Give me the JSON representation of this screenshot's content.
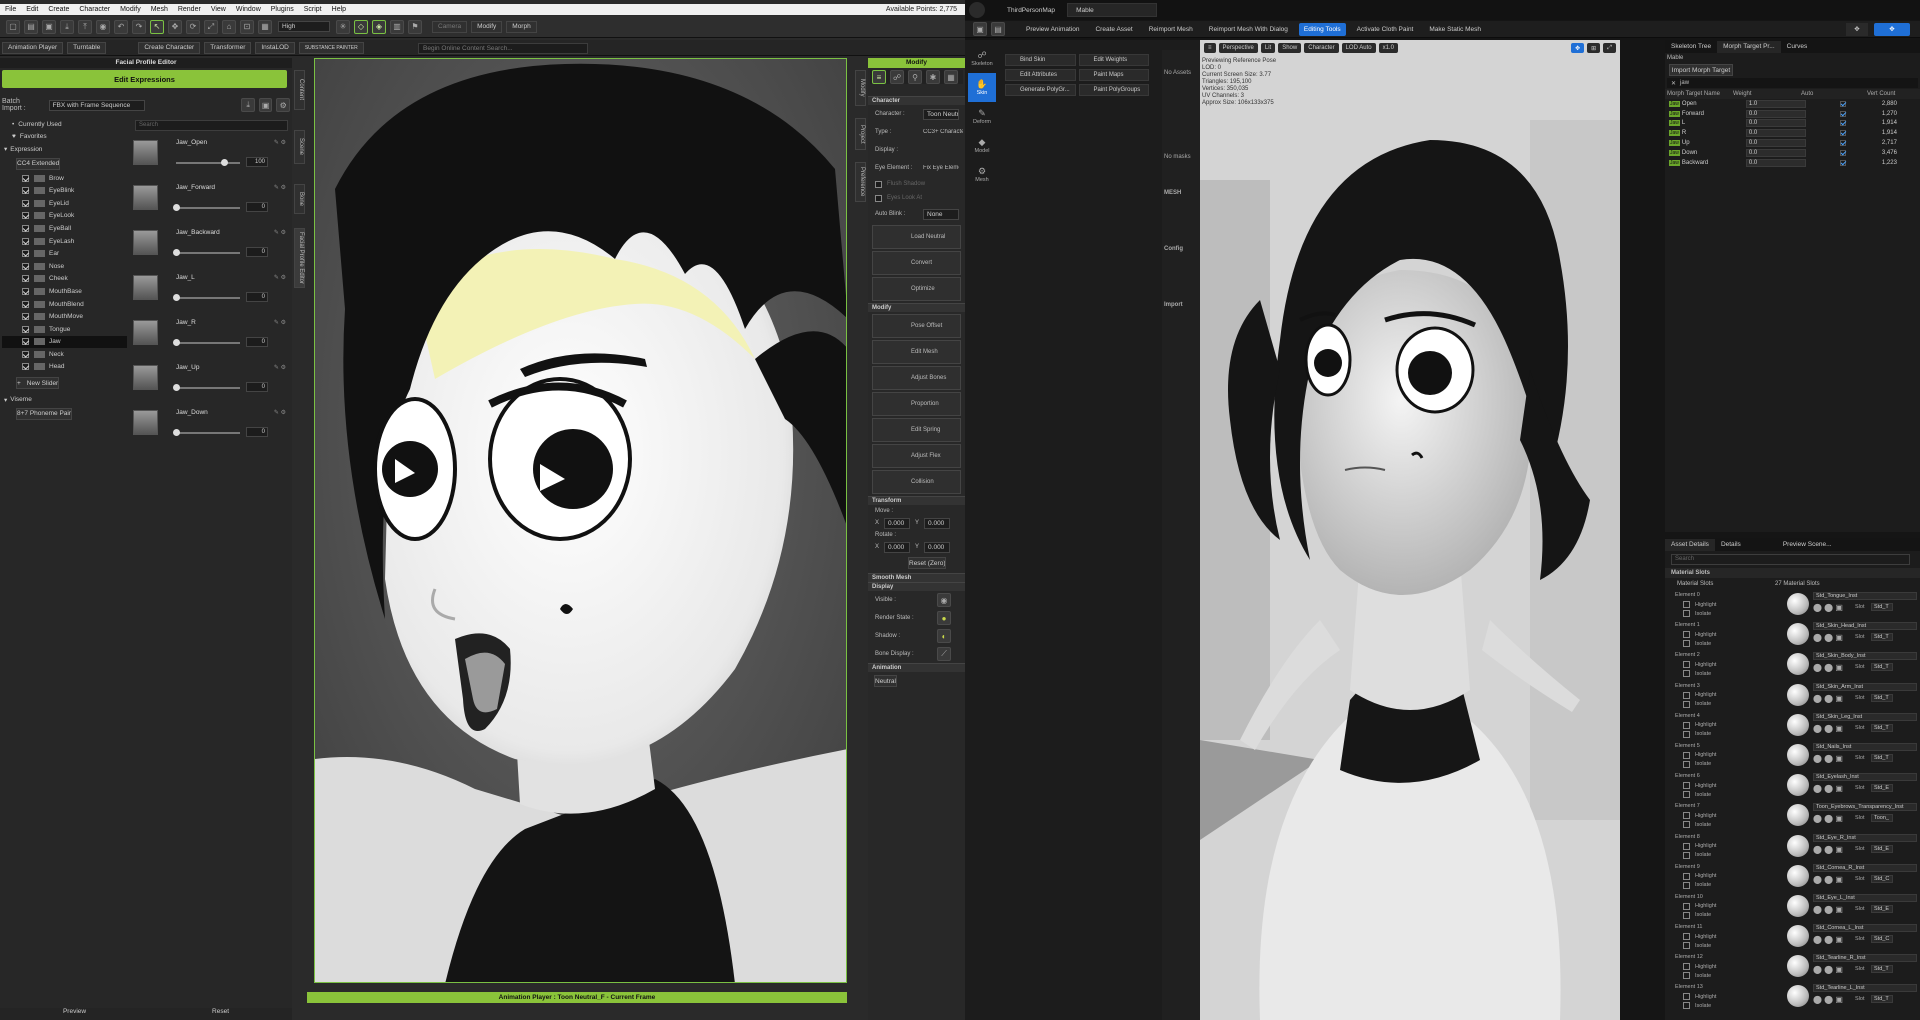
{
  "cc": {
    "menu": [
      "File",
      "Edit",
      "Create",
      "Character",
      "Modify",
      "Mesh",
      "Render",
      "View",
      "Window",
      "Plugins",
      "Script",
      "Help"
    ],
    "available_points": "Available Points: 2,775",
    "quality": "High",
    "toolbar_right": {
      "modify": "Modify",
      "morph": "Morph",
      "camera": "Camera"
    },
    "tabs": {
      "anim_player": "Animation Player",
      "turntable": "Turntable",
      "create_char": "Create Character",
      "transformer": "Transformer",
      "instalod": "InstaLOD",
      "substance": "SUBSTANCE PAINTER"
    },
    "search_placeholder": "Begin Online Content Search...",
    "fpe": {
      "title": "Facial Profile Editor",
      "edit_expressions": "Edit Expressions",
      "batch_label": "Batch Import :",
      "batch_value": "FBX with Frame Sequence",
      "currently_used": "Currently Used",
      "favorites": "Favorites",
      "expression": "Expression",
      "cc4_extended": "CC4 Extended",
      "items": [
        "Brow",
        "EyeBlink",
        "EyeLid",
        "EyeLook",
        "EyeBall",
        "EyeLash",
        "Ear",
        "Nose",
        "Cheek",
        "MouthBase",
        "MouthBlend",
        "MouthMove",
        "Tongue",
        "Jaw",
        "Neck",
        "Head"
      ],
      "new_slider": "New Slider",
      "viseme": "Viseme",
      "phoneme_pair": "8+7 Phoneme Pair",
      "search_placeholder": "Search",
      "sliders": [
        {
          "name": "Jaw_Open",
          "value": "100",
          "level": 0.75
        },
        {
          "name": "Jaw_Forward",
          "value": "0",
          "level": 0
        },
        {
          "name": "Jaw_Backward",
          "value": "0",
          "level": 0
        },
        {
          "name": "Jaw_L",
          "value": "0",
          "level": 0
        },
        {
          "name": "Jaw_R",
          "value": "0",
          "level": 0
        },
        {
          "name": "Jaw_Up",
          "value": "0",
          "level": 0
        },
        {
          "name": "Jaw_Down",
          "value": "0",
          "level": 0
        }
      ],
      "preview": "Preview",
      "reset": "Reset"
    },
    "vtabs": [
      "Content",
      "Scene",
      "Bone",
      "Facial Profile Editor"
    ],
    "vtabs_right": [
      "Modify",
      "Project",
      "Preference"
    ],
    "anim_footer": "Animation Player : Toon Neutral_F - Current Frame",
    "modify": {
      "title": "Modify",
      "character_sec": "Character",
      "character_label": "Character :",
      "character_value": "Toon Neutral",
      "type_label": "Type :",
      "type_value": "CC3+ Character",
      "display_label": "Display :",
      "eye_label": "Eye Element :",
      "eye_value": "Fix Eye Element",
      "flush_shadow": "Flush Shadow",
      "eyes_look": "Eyes Look At",
      "auto_blink": "Auto Blink :",
      "auto_blink_value": "None",
      "btns1": [
        "Load Neutral",
        "Convert",
        "Optimize"
      ],
      "modify_sec": "Modify",
      "btns2": [
        "Pose Offset",
        "Edit Mesh",
        "Adjust Bones",
        "Proportion",
        "Edit Spring",
        "Adjust Flex",
        "Collision"
      ],
      "transform_sec": "Transform",
      "move": "Move :",
      "rotate": "Rotate :",
      "x_val": "0.000",
      "y_val": "0.000",
      "reset_zero": "Reset (Zero)",
      "smooth_sec": "Smooth Mesh",
      "display_sec": "Display",
      "visible": "Visible :",
      "render_state": "Render State :",
      "shadow": "Shadow :",
      "bone_display": "Bone Display :",
      "animation_sec": "Animation",
      "neutral": "Neutral"
    }
  },
  "ue": {
    "tabs": [
      "ThirdPersonMap",
      "Mable"
    ],
    "toolbar": [
      "Preview Animation",
      "Create Asset",
      "Reimport Mesh",
      "Reimport Mesh With Dialog",
      "Editing Tools",
      "Activate Cloth Paint",
      "Make Static Mesh"
    ],
    "side": [
      "Skeleton",
      "Skin",
      "Deform",
      "Model",
      "Mesh"
    ],
    "tools": [
      "Bind Skin",
      "Edit Weights",
      "Edit Attributes",
      "Paint Maps",
      "Generate PolyGr...",
      "Paint PolyGroups"
    ],
    "no_assets": "No Assets",
    "no_masks": "No masks",
    "mesh": "MESH",
    "config": "Config",
    "import": "Import",
    "viewport_bar": [
      "Perspective",
      "Lit",
      "Show",
      "Character",
      "LOD Auto",
      "x1.0"
    ],
    "viewport_info": [
      "Previewing Reference Pose",
      "LOD: 0",
      "Current Screen Size: 3.77",
      "Triangles: 195,100",
      "Vertices: 350,035",
      "UV Channels: 3",
      "Approx Size: 106x133x375"
    ],
    "panel_tabs": [
      "Skeleton Tree",
      "Morph Target Pr...",
      "Curves"
    ],
    "mable_label": "Mable",
    "import_morph": "Import Morph Target",
    "filter": "jaw",
    "cols": [
      "Morph Target Name",
      "Weight",
      "Auto",
      "Vert Count"
    ],
    "morphs": [
      {
        "name": "Open",
        "weight": "1.0",
        "verts": "2,880"
      },
      {
        "name": "Forward",
        "weight": "0.0",
        "verts": "1,270"
      },
      {
        "name": "L",
        "weight": "0.0",
        "verts": "1,914"
      },
      {
        "name": "R",
        "weight": "0.0",
        "verts": "1,914"
      },
      {
        "name": "Up",
        "weight": "0.0",
        "verts": "2,717"
      },
      {
        "name": "Down",
        "weight": "0.0",
        "verts": "3,476"
      },
      {
        "name": "Backward",
        "weight": "0.0",
        "verts": "1,223"
      }
    ],
    "jaw_tag": "Jaw",
    "ad_tabs": [
      "Asset Details",
      "Details",
      "Preview Scene..."
    ],
    "search": "Search",
    "material_slots": "Material Slots",
    "material_slots_label": "Material Slots",
    "material_count": "27 Material Slots",
    "highlight": "Highlight",
    "isolate": "Isolate",
    "slot": "Slot",
    "elements": [
      {
        "label": "Element 0",
        "mat": "Std_Tongue_Inst",
        "slot": "Std_T"
      },
      {
        "label": "Element 1",
        "mat": "Std_Skin_Head_Inst",
        "slot": "Std_T"
      },
      {
        "label": "Element 2",
        "mat": "Std_Skin_Body_Inst",
        "slot": "Std_T"
      },
      {
        "label": "Element 3",
        "mat": "Std_Skin_Arm_Inst",
        "slot": "Std_T"
      },
      {
        "label": "Element 4",
        "mat": "Std_Skin_Leg_Inst",
        "slot": "Std_T"
      },
      {
        "label": "Element 5",
        "mat": "Std_Nails_Inst",
        "slot": "Std_T"
      },
      {
        "label": "Element 6",
        "mat": "Std_Eyelash_Inst",
        "slot": "Std_E"
      },
      {
        "label": "Element 7",
        "mat": "Toon_Eyebrows_Transparency_Inst",
        "slot": "Toon_"
      },
      {
        "label": "Element 8",
        "mat": "Std_Eye_R_Inst",
        "slot": "Std_E"
      },
      {
        "label": "Element 9",
        "mat": "Std_Cornea_R_Inst",
        "slot": "Std_C"
      },
      {
        "label": "Element 10",
        "mat": "Std_Eye_L_Inst",
        "slot": "Std_E"
      },
      {
        "label": "Element 11",
        "mat": "Std_Cornea_L_Inst",
        "slot": "Std_C"
      },
      {
        "label": "Element 12",
        "mat": "Std_Tearline_R_Inst",
        "slot": "Std_T"
      },
      {
        "label": "Element 13",
        "mat": "Std_Tearline_L_Inst",
        "slot": "Std_T"
      }
    ]
  },
  "colors": {
    "accent_green": "#8ac33a",
    "ue_blue": "#1f6fd6"
  }
}
